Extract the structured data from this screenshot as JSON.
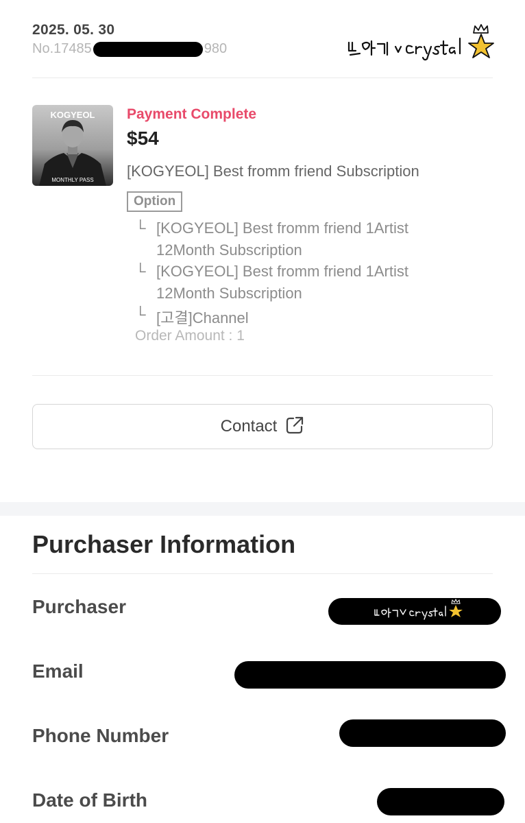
{
  "order": {
    "date": "2025. 05. 30",
    "number_prefix": "No.17485",
    "number_suffix": "980"
  },
  "signature_text": "부용기 ∨ Crystal",
  "product": {
    "thumbnail": {
      "brand": "KOGYEOL",
      "caption": "MONTHLY PASS"
    },
    "status": "Payment Complete",
    "price": "$54",
    "name": "[KOGYEOL] Best fromm friend Subscription",
    "option_label": "Option",
    "option_mark": "└",
    "options": [
      {
        "line1": "[KOGYEOL] Best fromm friend 1Artist",
        "line2": "12Month Subscription"
      },
      {
        "line1": "[KOGYEOL] Best fromm friend 1Artist",
        "line2": "12Month Subscription"
      },
      {
        "line1": "[고결]Channel",
        "line2": ""
      }
    ],
    "order_amount": "Order Amount : 1"
  },
  "contact": {
    "label": "Contact",
    "icon": "external-link-icon"
  },
  "purchaser": {
    "title": "Purchaser Information",
    "fields": {
      "purchaser": "Purchaser",
      "email": "Email",
      "phone": "Phone Number",
      "dob": "Date of Birth"
    }
  },
  "colors": {
    "status": "#e84a6a",
    "redaction": "#000000",
    "star": "#f2c230",
    "divider": "#ebebeb"
  }
}
